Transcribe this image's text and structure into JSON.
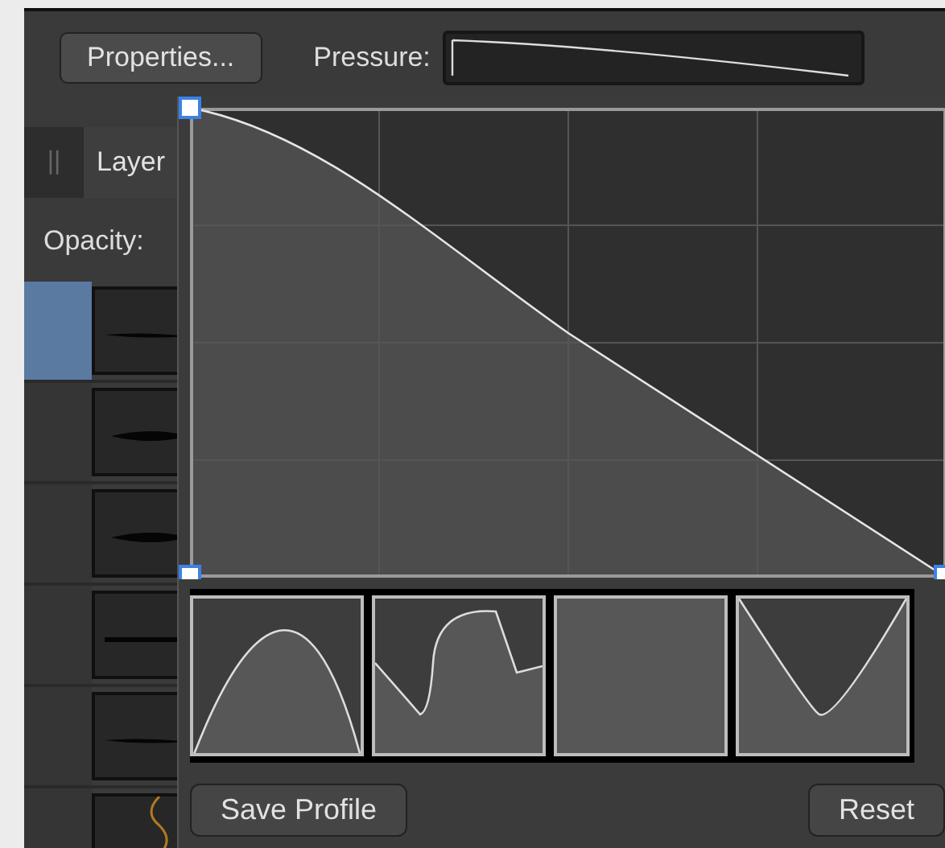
{
  "toolbar": {
    "properties_button": "Properties...",
    "pressure_label": "Pressure:"
  },
  "layers_panel": {
    "grip": "||",
    "tab": "Layer",
    "opacity_label": "Opacity:",
    "brushes": [
      {
        "kind": "taper",
        "selected": true
      },
      {
        "kind": "swell",
        "selected": false
      },
      {
        "kind": "swell",
        "selected": false
      },
      {
        "kind": "line",
        "selected": false
      },
      {
        "kind": "taper",
        "selected": false
      },
      {
        "kind": "squiggle",
        "selected": false
      }
    ]
  },
  "curve_editor": {
    "presets": [
      {
        "kind": "arch"
      },
      {
        "kind": "wave"
      },
      {
        "kind": "flat"
      },
      {
        "kind": "valley"
      }
    ]
  },
  "buttons": [
    "Save Profile",
    "Reset"
  ]
}
